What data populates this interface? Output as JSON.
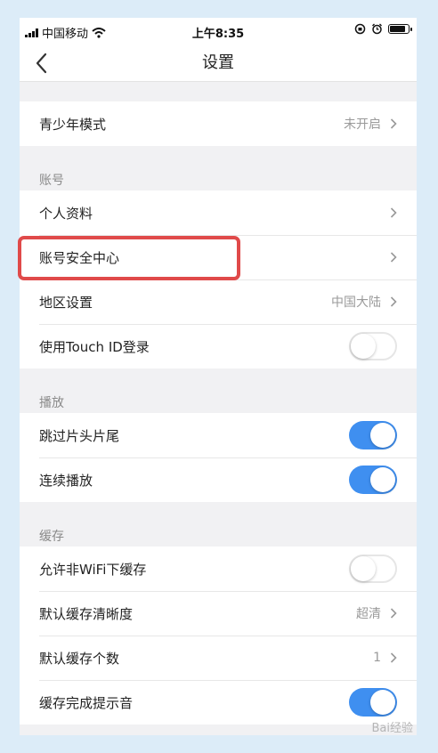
{
  "status": {
    "carrier": "中国移动",
    "time": "上午8:35"
  },
  "nav": {
    "title": "设置"
  },
  "rows": {
    "youth_label": "青少年模式",
    "youth_value": "未开启",
    "section_account": "账号",
    "profile_label": "个人资料",
    "security_label": "账号安全中心",
    "region_label": "地区设置",
    "region_value": "中国大陆",
    "touchid_label": "使用Touch ID登录",
    "section_play": "播放",
    "skip_label": "跳过片头片尾",
    "continuous_label": "连续播放",
    "section_cache": "缓存",
    "wifi_cache_label": "允许非WiFi下缓存",
    "quality_label": "默认缓存清晰度",
    "quality_value": "超清",
    "count_label": "默认缓存个数",
    "count_value": "1",
    "sound_label": "缓存完成提示音"
  },
  "toggles": {
    "touchid": false,
    "skip": true,
    "continuous": true,
    "wifi_cache": false,
    "sound": true
  },
  "watermark": "Bai经验",
  "colors": {
    "accent": "#3f8ff0",
    "highlight": "#e04a4a"
  }
}
